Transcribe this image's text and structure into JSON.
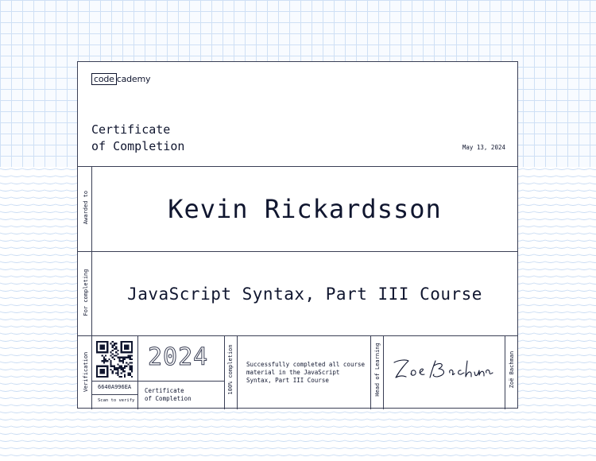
{
  "brand": {
    "logo_part1": "code",
    "logo_part2": "cademy"
  },
  "certificate": {
    "title": "Certificate\nof Completion",
    "date": "May 13, 2024",
    "awarded_to_label": "Awarded to",
    "recipient": "Kevin Rickardsson",
    "for_completing_label": "For completing",
    "course": "JavaScript Syntax, Part III Course"
  },
  "footer": {
    "verification_label": "Verification",
    "certificate_id": "6640A996EA",
    "scan_label": "Scan to verify",
    "year": "2024",
    "small_title": "Certificate\nof Completion",
    "completion_label": "100% completion",
    "description": "Successfully completed all course\nmaterial in the JavaScript\nSyntax, Part III Course",
    "signer_role": "Head of Learning",
    "signature_text": "Zoe Bachman",
    "signer_name": "Zoë Bachman"
  },
  "colors": {
    "ink": "#10162f",
    "grid": "#cfe0f5",
    "wave": "#c9dcf3"
  }
}
